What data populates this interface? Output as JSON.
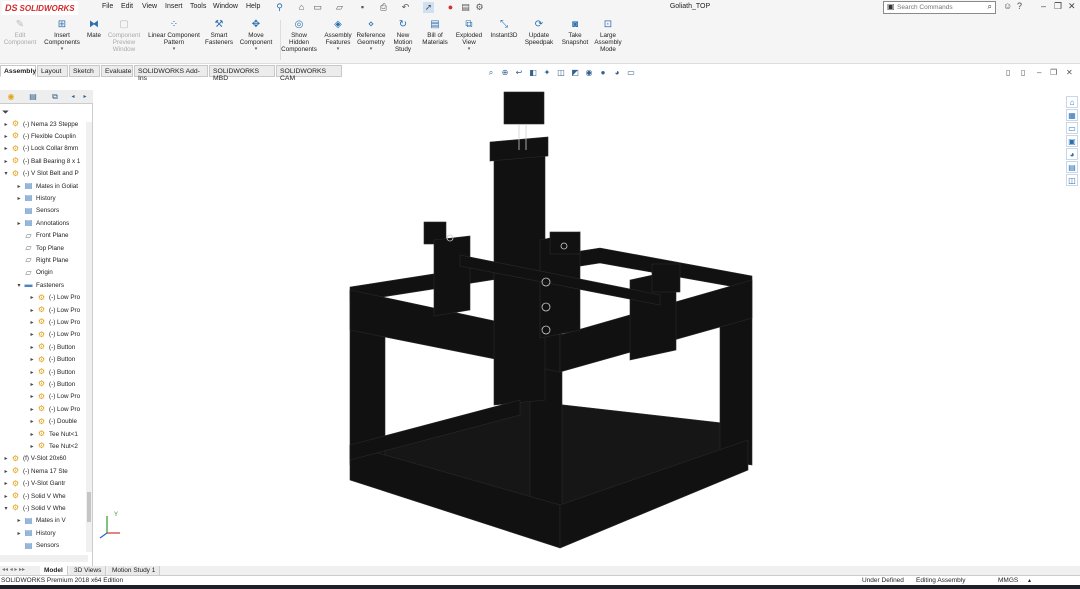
{
  "app": {
    "brand_ds": "DS",
    "brand_name": "SOLIDWORKS",
    "window_title": "Goliath_TOP",
    "search_placeholder": "Search Commands"
  },
  "menu": [
    "File",
    "Edit",
    "View",
    "Insert",
    "Tools",
    "Window",
    "Help"
  ],
  "ribbon": {
    "buttons": [
      {
        "label": "Edit\nComponent",
        "icon": "edit-component-icon",
        "disabled": true
      },
      {
        "label": "Insert\nComponents",
        "icon": "insert-components-icon",
        "disabled": false
      },
      {
        "label": "Mate",
        "icon": "mate-icon",
        "disabled": false
      },
      {
        "label": "Component\nPreview\nWindow",
        "icon": "component-preview-icon",
        "disabled": true
      },
      {
        "label": "Linear Component\nPattern",
        "icon": "linear-pattern-icon",
        "disabled": false
      },
      {
        "label": "Smart\nFasteners",
        "icon": "smart-fasteners-icon",
        "disabled": false
      },
      {
        "label": "Move\nComponent",
        "icon": "move-component-icon",
        "disabled": false
      },
      {
        "label": "Show\nHidden\nComponents",
        "icon": "show-hidden-icon",
        "disabled": false
      },
      {
        "label": "Assembly\nFeatures",
        "icon": "assembly-features-icon",
        "disabled": false
      },
      {
        "label": "Reference\nGeometry",
        "icon": "reference-geometry-icon",
        "disabled": false
      },
      {
        "label": "New\nMotion\nStudy",
        "icon": "motion-study-icon",
        "disabled": false
      },
      {
        "label": "Bill of\nMaterials",
        "icon": "bom-icon",
        "disabled": false
      },
      {
        "label": "Exploded\nView",
        "icon": "exploded-view-icon",
        "disabled": false
      },
      {
        "label": "Instant3D",
        "icon": "instant3d-icon",
        "disabled": false
      },
      {
        "label": "Update\nSpeedpak",
        "icon": "speedpak-icon",
        "disabled": false
      },
      {
        "label": "Take\nSnapshot",
        "icon": "snapshot-icon",
        "disabled": false
      },
      {
        "label": "Large\nAssembly\nMode",
        "icon": "large-assembly-icon",
        "disabled": false
      }
    ]
  },
  "tabs": [
    "Assembly",
    "Layout",
    "Sketch",
    "Evaluate",
    "SOLIDWORKS Add-Ins",
    "SOLIDWORKS MBD",
    "SOLIDWORKS CAM"
  ],
  "tree": [
    {
      "label": "(-) Nema 23 Steppe",
      "type": "asm",
      "level": 0,
      "tw": "▸"
    },
    {
      "label": "(-) Flexible Couplin",
      "type": "asm",
      "level": 0,
      "tw": "▸"
    },
    {
      "label": "(-) Lock Collar 8mm",
      "type": "asm",
      "level": 0,
      "tw": "▸"
    },
    {
      "label": "(-) Ball Bearing 8 x 1",
      "type": "asm",
      "level": 0,
      "tw": "▸"
    },
    {
      "label": "(-) V Slot Belt and P",
      "type": "asm",
      "level": 0,
      "tw": "▾"
    },
    {
      "label": "Mates in Goliat",
      "type": "doc",
      "level": 1,
      "tw": "▸"
    },
    {
      "label": "History",
      "type": "doc",
      "level": 1,
      "tw": "▸"
    },
    {
      "label": "Sensors",
      "type": "doc",
      "level": 1,
      "tw": ""
    },
    {
      "label": "Annotations",
      "type": "doc",
      "level": 1,
      "tw": "▸"
    },
    {
      "label": "Front Plane",
      "type": "plane",
      "level": 1,
      "tw": ""
    },
    {
      "label": "Top Plane",
      "type": "plane",
      "level": 1,
      "tw": ""
    },
    {
      "label": "Right Plane",
      "type": "plane",
      "level": 1,
      "tw": ""
    },
    {
      "label": "Origin",
      "type": "plane",
      "level": 1,
      "tw": ""
    },
    {
      "label": "Fasteners",
      "type": "fold",
      "level": 1,
      "tw": "▾"
    },
    {
      "label": "(-) Low Pro",
      "type": "asm",
      "level": 2,
      "tw": "▸"
    },
    {
      "label": "(-) Low Pro",
      "type": "asm",
      "level": 2,
      "tw": "▸"
    },
    {
      "label": "(-) Low Pro",
      "type": "asm",
      "level": 2,
      "tw": "▸"
    },
    {
      "label": "(-) Low Pro",
      "type": "asm",
      "level": 2,
      "tw": "▸"
    },
    {
      "label": "(-) Button",
      "type": "asm",
      "level": 2,
      "tw": "▸"
    },
    {
      "label": "(-) Button",
      "type": "asm",
      "level": 2,
      "tw": "▸"
    },
    {
      "label": "(-) Button",
      "type": "asm",
      "level": 2,
      "tw": "▸"
    },
    {
      "label": "(-) Button",
      "type": "asm",
      "level": 2,
      "tw": "▸"
    },
    {
      "label": "(-) Low Pro",
      "type": "asm",
      "level": 2,
      "tw": "▸"
    },
    {
      "label": "(-) Low Pro",
      "type": "asm",
      "level": 2,
      "tw": "▸"
    },
    {
      "label": "(-) Double",
      "type": "asm",
      "level": 2,
      "tw": "▸"
    },
    {
      "label": "Tee Nut<1",
      "type": "asm",
      "level": 2,
      "tw": "▸"
    },
    {
      "label": "Tee Nut<2",
      "type": "asm",
      "level": 2,
      "tw": "▸"
    },
    {
      "label": "(f) V-Slot 20x60",
      "type": "asm",
      "level": 0,
      "tw": "▸"
    },
    {
      "label": "(-) Nema 17 Ste",
      "type": "asm",
      "level": 0,
      "tw": "▸"
    },
    {
      "label": "(-) V-Slot Gantr",
      "type": "asm",
      "level": 0,
      "tw": "▸"
    },
    {
      "label": "(-) Solid V Whe",
      "type": "asm",
      "level": 0,
      "tw": "▸"
    },
    {
      "label": "(-) Solid V Whe",
      "type": "asm",
      "level": 0,
      "tw": "▾"
    },
    {
      "label": "Mates in V",
      "type": "doc",
      "level": 1,
      "tw": "▸"
    },
    {
      "label": "History",
      "type": "doc",
      "level": 1,
      "tw": "▸"
    },
    {
      "label": "Sensors",
      "type": "doc",
      "level": 1,
      "tw": ""
    }
  ],
  "bottom_tabs": [
    "Model",
    "3D Views",
    "Motion Study 1"
  ],
  "status": {
    "edition": "SOLIDWORKS Premium 2018 x64 Edition",
    "defined": "Under Defined",
    "mode": "Editing Assembly",
    "units": "MMGS"
  },
  "colors": {
    "brand": "#d12b2b",
    "model": "#111111",
    "accent": "#2a6fb0"
  }
}
